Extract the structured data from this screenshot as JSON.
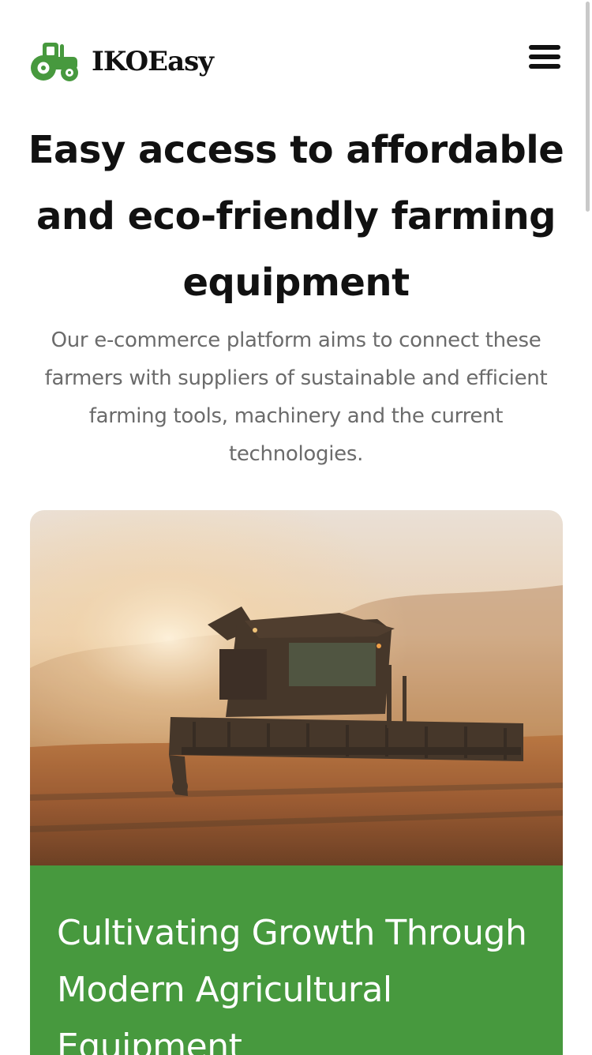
{
  "brand": {
    "name": "IKOEasy",
    "accent_color": "#47993e",
    "logo_icon": "tractor-icon"
  },
  "header": {
    "menu_icon": "hamburger-menu-icon"
  },
  "hero": {
    "heading": "Easy access to affordable and eco-friendly farming equipment",
    "description": "Our e-commerce platform aims to connect these farmers with suppliers of sustainable and efficient farming tools, machinery and the current technologies."
  },
  "feature_card": {
    "image": "combine-harvester-field-photo",
    "title": "Cultivating Growth Through Modern Agricultural Equipment",
    "background_color": "#47993e"
  }
}
